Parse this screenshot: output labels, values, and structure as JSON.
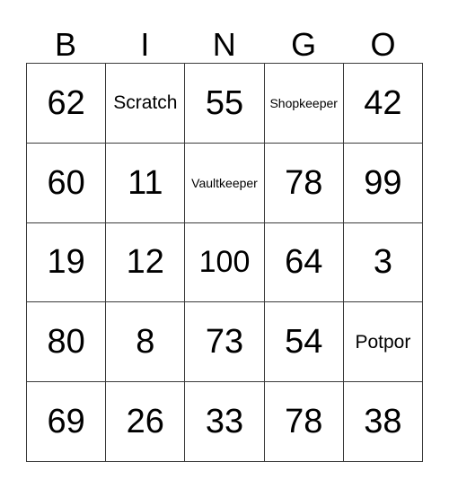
{
  "card": {
    "headers": [
      "B",
      "I",
      "N",
      "G",
      "O"
    ],
    "colors": {
      "border": "#3a3a3a",
      "background": "#ffffff",
      "text": "#000000"
    },
    "rows": [
      [
        {
          "value": "62",
          "kind": "number"
        },
        {
          "value": "Scratch",
          "kind": "word"
        },
        {
          "value": "55",
          "kind": "number"
        },
        {
          "value": "Shopkeeper",
          "kind": "word"
        },
        {
          "value": "42",
          "kind": "number"
        }
      ],
      [
        {
          "value": "60",
          "kind": "number"
        },
        {
          "value": "11",
          "kind": "number"
        },
        {
          "value": "Vaultkeeper",
          "kind": "word"
        },
        {
          "value": "78",
          "kind": "number"
        },
        {
          "value": "99",
          "kind": "number"
        }
      ],
      [
        {
          "value": "19",
          "kind": "number"
        },
        {
          "value": "12",
          "kind": "number"
        },
        {
          "value": "100",
          "kind": "number"
        },
        {
          "value": "64",
          "kind": "number"
        },
        {
          "value": "3",
          "kind": "number"
        }
      ],
      [
        {
          "value": "80",
          "kind": "number"
        },
        {
          "value": "8",
          "kind": "number"
        },
        {
          "value": "73",
          "kind": "number"
        },
        {
          "value": "54",
          "kind": "number"
        },
        {
          "value": "Potpor",
          "kind": "word"
        }
      ],
      [
        {
          "value": "69",
          "kind": "number"
        },
        {
          "value": "26",
          "kind": "number"
        },
        {
          "value": "33",
          "kind": "number"
        },
        {
          "value": "78",
          "kind": "number"
        },
        {
          "value": "38",
          "kind": "number"
        }
      ]
    ]
  }
}
